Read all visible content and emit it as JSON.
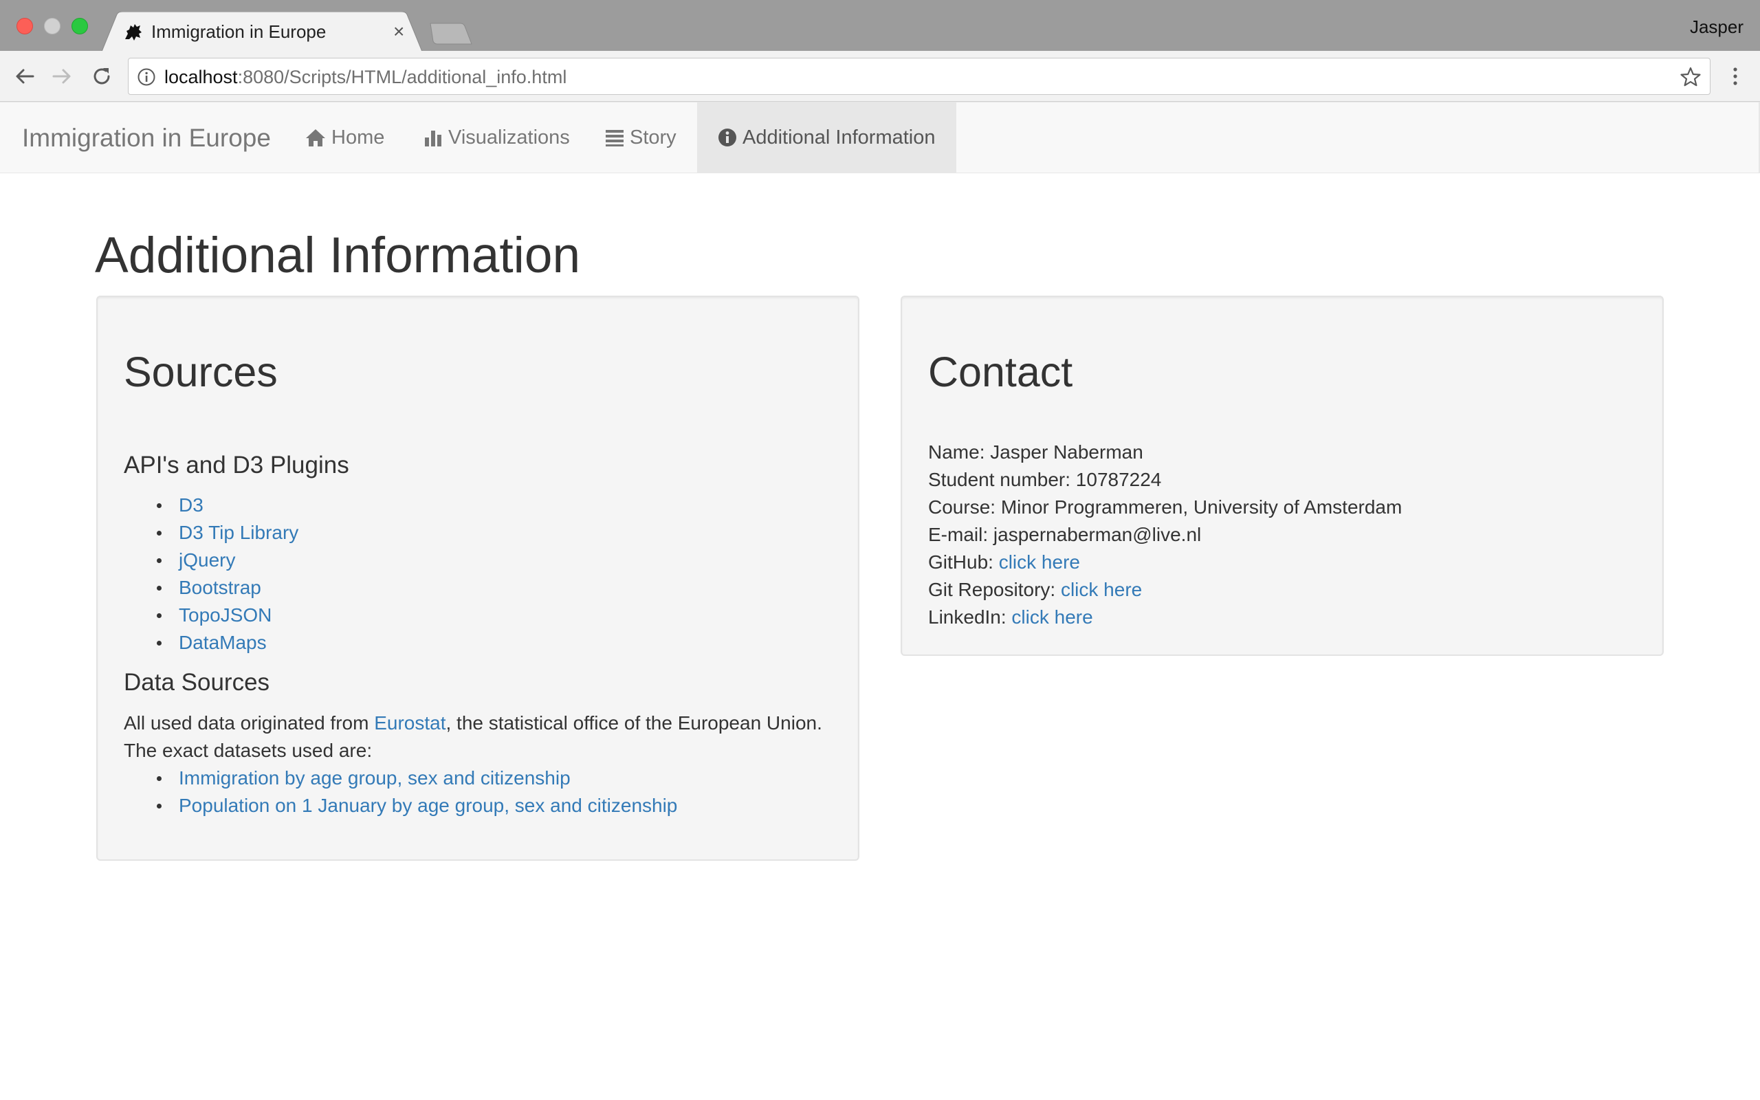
{
  "browser": {
    "tab_title": "Immigration in Europe",
    "tab_close": "×",
    "profile_name": "Jasper",
    "url_host": "localhost",
    "url_path": ":8080/Scripts/HTML/additional_info.html"
  },
  "navbar": {
    "brand": "Immigration in Europe",
    "items": [
      {
        "label": "Home",
        "icon": "home-icon"
      },
      {
        "label": "Visualizations",
        "icon": "bar-chart-icon"
      },
      {
        "label": "Story",
        "icon": "list-icon"
      },
      {
        "label": "Additional Information",
        "icon": "info-icon",
        "active": true
      }
    ]
  },
  "page": {
    "title": "Additional Information"
  },
  "sources": {
    "heading": "Sources",
    "apis_heading": "API's and D3 Plugins",
    "apis": [
      "D3",
      "D3 Tip Library",
      "jQuery",
      "Bootstrap",
      "TopoJSON",
      "DataMaps"
    ],
    "data_heading": "Data Sources",
    "data_text_before": "All used data originated from ",
    "data_link": "Eurostat",
    "data_text_after": ", the statistical office of the European Union.",
    "data_text_line2": "The exact datasets used are:",
    "datasets": [
      "Immigration by age group, sex and citizenship",
      "Population on 1 January by age group, sex and citizenship"
    ]
  },
  "contact": {
    "heading": "Contact",
    "name": "Name: Jasper Naberman",
    "student_number": "Student number: 10787224",
    "course": "Course: Minor Programmeren, University of Amsterdam",
    "email": "E-mail: jaspernaberman@live.nl",
    "github_label": "GitHub: ",
    "github_link": "click here",
    "repo_label": "Git Repository: ",
    "repo_link": "click here",
    "linkedin_label": "LinkedIn: ",
    "linkedin_link": "click here"
  },
  "colors": {
    "link": "#337ab7",
    "navbar_bg": "#f8f8f8",
    "well_bg": "#f5f5f5",
    "titlebar_bg": "#9c9c9c"
  }
}
